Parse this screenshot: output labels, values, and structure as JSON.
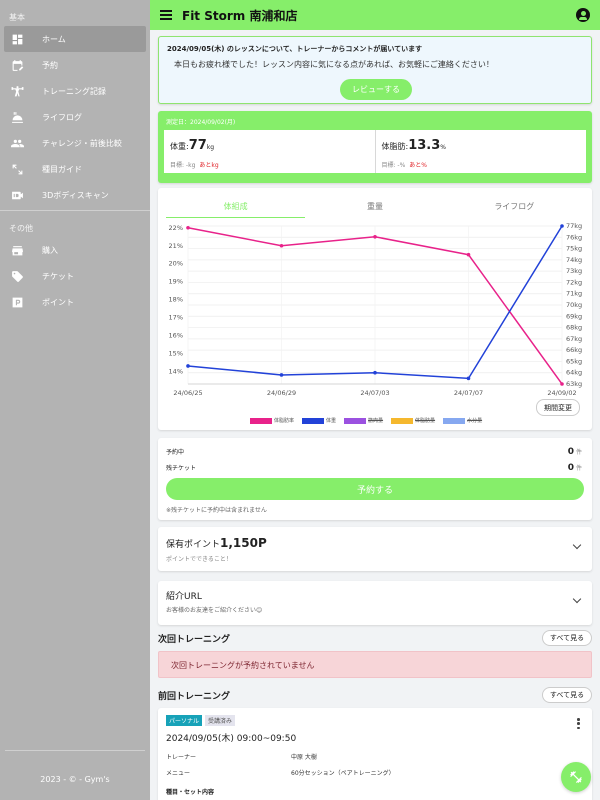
{
  "header": {
    "title": "Fit Storm 南浦和店"
  },
  "sidebar": {
    "section_basic": "基本",
    "section_other": "その他",
    "items": [
      {
        "label": "ホーム"
      },
      {
        "label": "予約"
      },
      {
        "label": "トレーニング記録"
      },
      {
        "label": "ライフログ"
      },
      {
        "label": "チャレンジ・前後比較"
      },
      {
        "label": "種目ガイド"
      },
      {
        "label": "3Dボディスキャン"
      }
    ],
    "other_items": [
      {
        "label": "購入"
      },
      {
        "label": "チケット"
      },
      {
        "label": "ポイント"
      }
    ],
    "footer": "2023 - © - Gym's"
  },
  "notice": {
    "title": "2024/09/05(木) のレッスンについて、トレーナーからコメントが届いています",
    "message": "本日もお疲れ様でした！レッスン内容に気になる点があれば、お気軽にご連絡ください！",
    "button": "レビューする"
  },
  "measure": {
    "date": "測定日：2024/09/02(月)",
    "weight_label": "体重:",
    "weight_value": "77",
    "weight_unit": "kg",
    "weight_target": "目標: -kg",
    "weight_remain": "あとkg",
    "fat_label": "体脂肪:",
    "fat_value": "13.3",
    "fat_unit": "%",
    "fat_target": "目標: -%",
    "fat_remain": "あと%"
  },
  "chart_tabs": [
    "体組成",
    "重量",
    "ライフログ"
  ],
  "chart_data": {
    "type": "line",
    "x": [
      "24/06/25",
      "24/06/29",
      "24/07/03",
      "24/07/07",
      "24/09/02"
    ],
    "series": [
      {
        "name": "体脂肪率",
        "axis": "left",
        "color": "#e8228a",
        "values": [
          22,
          21,
          21.5,
          20.5,
          13.3
        ]
      },
      {
        "name": "体重",
        "axis": "right",
        "color": "#2242d8",
        "values": [
          64.6,
          63.8,
          64,
          63.5,
          77
        ]
      }
    ],
    "left_axis": {
      "ticks": [
        14,
        15,
        16,
        17,
        18,
        19,
        20,
        21,
        22
      ],
      "suffix": "%",
      "range": [
        13.3,
        22.1
      ]
    },
    "right_axis": {
      "ticks": [
        63,
        64,
        65,
        66,
        67,
        68,
        69,
        70,
        71,
        72,
        73,
        74,
        75,
        76,
        77
      ],
      "suffix": "kg",
      "range": [
        63,
        77
      ]
    },
    "legend": [
      {
        "name": "体脂肪率",
        "color": "#e8228a",
        "active": true
      },
      {
        "name": "体重",
        "color": "#2242d8",
        "active": true
      },
      {
        "name": "筋肉量",
        "color": "#9b51e0",
        "active": false
      },
      {
        "name": "体脂肪量",
        "color": "#f5b82e",
        "active": false
      },
      {
        "name": "水分量",
        "color": "#86a8f0",
        "active": false
      }
    ]
  },
  "period_button": "期間変更",
  "reserve": {
    "booked_label": "予約中",
    "booked_value": "0",
    "ticket_label": "残チケット",
    "ticket_value": "0",
    "unit": "件",
    "button": "予約する",
    "note": "※残チケットに予約中は含まれません"
  },
  "points": {
    "label": "保有ポイント",
    "value": "1,150P",
    "sub": "ポイントでできること！"
  },
  "referral": {
    "title": "紹介URL",
    "sub": "お客様のお友達をご紹介ください😊"
  },
  "next_training": {
    "title": "次回トレーニング",
    "see_all": "すべて見る",
    "empty": "次回トレーニングが予約されていません"
  },
  "last_training": {
    "title": "前回トレーニング",
    "see_all": "すべて見る",
    "tag_type": "パーソナル",
    "tag_status": "受講済み",
    "datetime": "2024/09/05(木) 09:00~09:50",
    "trainer_label": "トレーナー",
    "trainer_value": "中原 大樹",
    "menu_label": "メニュー",
    "menu_value": "60分セッション（ペアトレーニング）",
    "detail_label": "種目・セット内容"
  },
  "colors": {
    "accent": "#86ee6a",
    "sidebar": "#b3b3b3"
  }
}
